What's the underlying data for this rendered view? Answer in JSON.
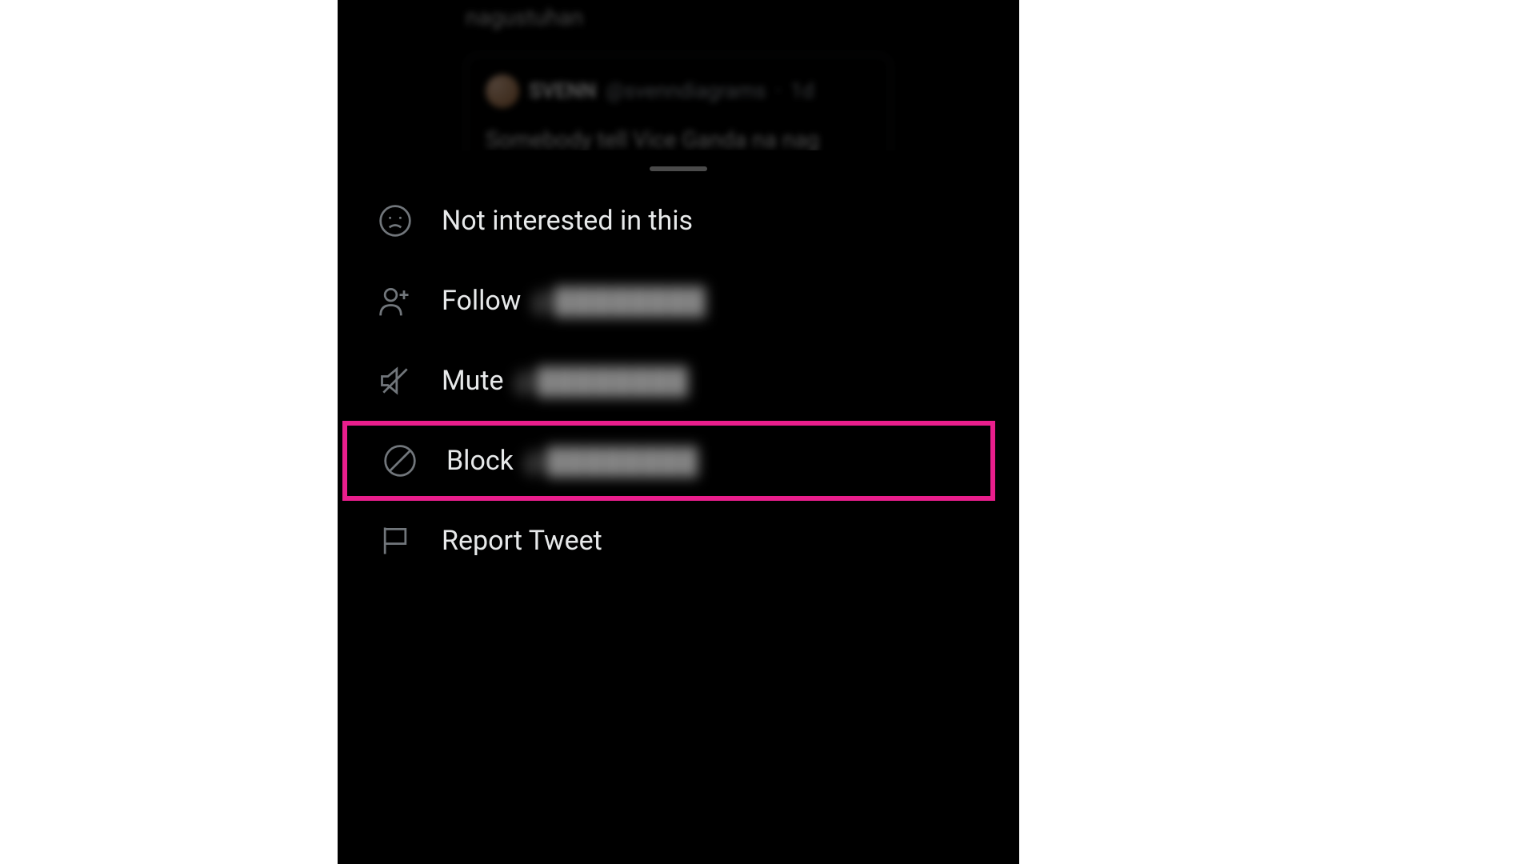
{
  "background": {
    "parent_text_fragment": "nagustuhan",
    "quoted": {
      "display_name": "SVENN",
      "username": "@svenndiagrams",
      "timestamp": "1d",
      "body": "Somebody tell Vice Ganda na nag extend ang quarantine dahil kulang ang mass testing at walang"
    }
  },
  "menu": {
    "not_interested": "Not interested in this",
    "follow": "Follow",
    "follow_handle": "@████████",
    "mute": "Mute",
    "mute_handle": "@████████",
    "block": "Block",
    "block_handle": "@████████",
    "report": "Report Tweet"
  },
  "highlight": {
    "color": "#e91e8c"
  }
}
